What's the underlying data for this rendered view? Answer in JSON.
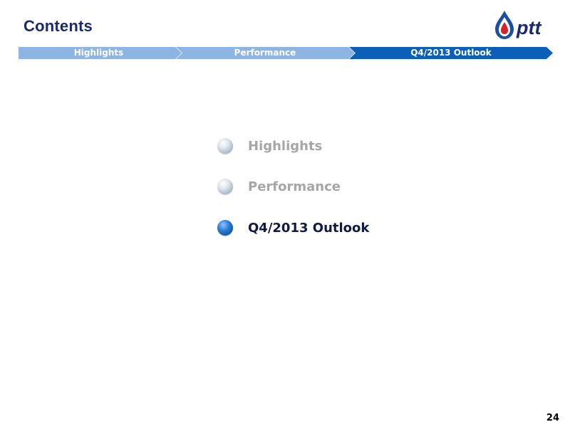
{
  "header": {
    "title": "Contents",
    "logo_text": "ptt"
  },
  "nav": {
    "items": [
      {
        "label": "Highlights",
        "active": false
      },
      {
        "label": "Performance",
        "active": false
      },
      {
        "label": "Q4/2013 Outlook",
        "active": true
      }
    ]
  },
  "contents": {
    "items": [
      {
        "label": "Highlights",
        "active": false
      },
      {
        "label": "Performance",
        "active": false
      },
      {
        "label": "Q4/2013 Outlook",
        "active": true
      }
    ]
  },
  "footer": {
    "page_number": "24"
  },
  "colors": {
    "title": "#1b2a6b",
    "nav_inactive": "#8db4e2",
    "nav_active": "#0b5fb8",
    "label_inactive": "#a6a6a6",
    "label_active": "#0f1a45",
    "logo_text": "#1b2a6b",
    "logo_flame_red": "#d6232a"
  }
}
